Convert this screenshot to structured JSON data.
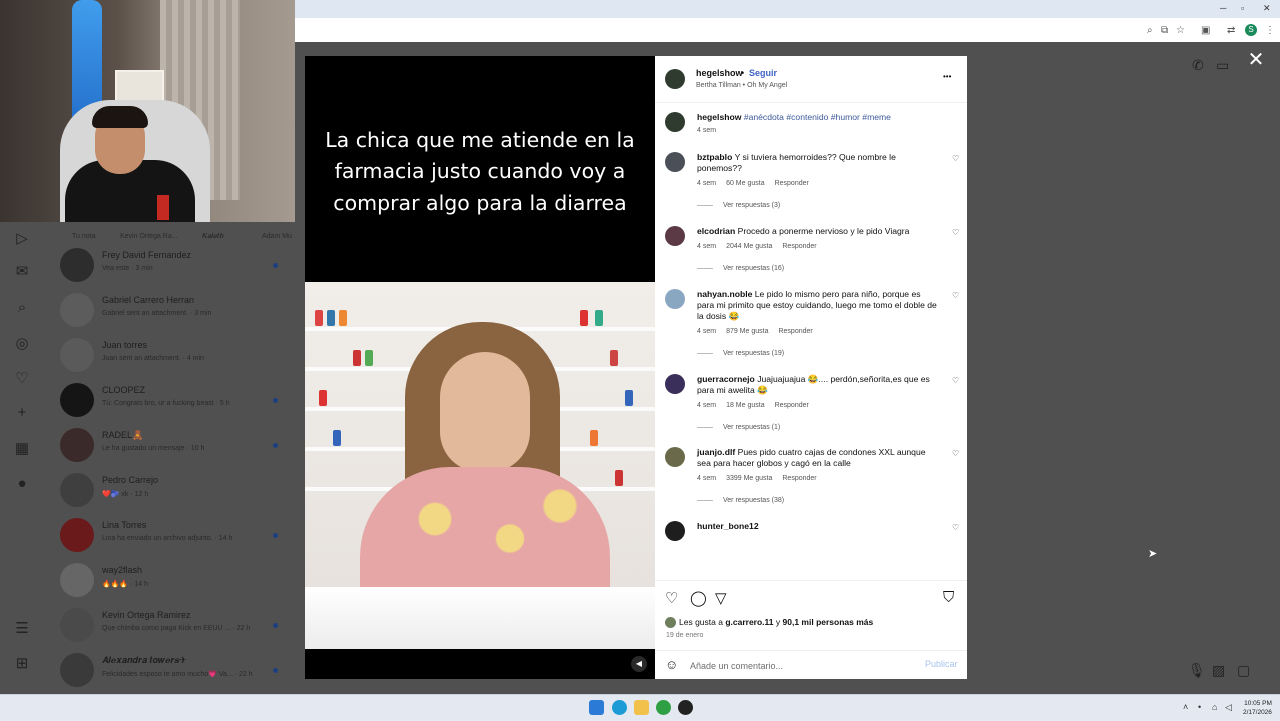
{
  "dm_sidebar": {
    "story_labels": [
      "Tu nota",
      "Kevin Ortega Ra...",
      "𝑲𝒂𝒍𝒆𝒕𝒉",
      "Adam Mu"
    ],
    "conversations": [
      {
        "name": "Frey David Fernandez",
        "preview": "Vea este · 3 min",
        "unread": true
      },
      {
        "name": "Gabriel Carrero Herran",
        "preview": "Gabriel sent an attachment. · 3 min",
        "unread": false
      },
      {
        "name": "Juan torres",
        "preview": "Juan sent an attachment. · 4 min",
        "unread": false
      },
      {
        "name": "CLOOPEZ",
        "preview": "Tú: Congrats bro, ur a fucking beast · 5 h",
        "unread": true
      },
      {
        "name": "RADEL🧸",
        "preview": "Le ha gustado un mensaje · 10 h",
        "unread": true
      },
      {
        "name": "Pedro Carrejo",
        "preview": "❤️🫐 xk · 12 h",
        "unread": false
      },
      {
        "name": "Lina Torres",
        "preview": "Lina ha enviado un archivo adjunto. · 14 h",
        "unread": true
      },
      {
        "name": "way2flash",
        "preview": "🔥🔥🔥 · 14 h",
        "unread": false
      },
      {
        "name": "Kevin Ortega Ramirez",
        "preview": "Que chimba como paga Kick en EEUU ... · 22 h",
        "unread": true
      },
      {
        "name": "𝑨𝒍𝒆𝒙𝒂𝒏𝒅𝒓𝒂 𝒕𝒐𝒘𝒆𝒓𝒔✈",
        "preview": "Felicidades esposo te amo mucho💗 Va... · 22 h",
        "unread": true
      }
    ]
  },
  "post": {
    "author": "hegelshow",
    "separator": "•",
    "follow_label": "Seguir",
    "audio": "Bertha Tillman • Oh My Angel",
    "more_label": "•••",
    "video_caption": [
      "La chica que me atiende en la",
      "farmacia justo cuando voy a",
      "comprar algo para la diarrea"
    ],
    "caption": {
      "author": "hegelshow",
      "text": "#anécdota #contenido #humor #meme",
      "time": "4 sem"
    },
    "comments": [
      {
        "user": "bztpablo",
        "text": "Y si tuviera hemorroides?? Que nombre le ponemos??",
        "time": "4 sem",
        "likes": "60 Me gusta",
        "reply": "Responder",
        "replies": "Ver respuestas (3)"
      },
      {
        "user": "elcodrian",
        "text": "Procedo a ponerme nervioso y le pido Viagra",
        "time": "4 sem",
        "likes": "2044 Me gusta",
        "reply": "Responder",
        "replies": "Ver respuestas (16)"
      },
      {
        "user": "nahyan.noble",
        "text": "Le pido lo mismo pero para niño, porque es para mi primito que estoy cuidando, luego me tomo el doble de la dosis 😂",
        "time": "4 sem",
        "likes": "879 Me gusta",
        "reply": "Responder",
        "replies": "Ver respuestas (19)"
      },
      {
        "user": "guerracornejo",
        "text": "Juajuajuajua 😂.... perdón,señorita,es que es para mi awelita 😂",
        "time": "4 sem",
        "likes": "18 Me gusta",
        "reply": "Responder",
        "replies": "Ver respuestas (1)"
      },
      {
        "user": "juanjo.dlf",
        "text": "Pues pido cuatro cajas de condones XXL aunque sea para hacer globos y cagó en la calle",
        "time": "4 sem",
        "likes": "3399 Me gusta",
        "reply": "Responder",
        "replies": "Ver respuestas (38)"
      },
      {
        "user": "hunter_bone12",
        "text": "",
        "time": "",
        "likes": "",
        "reply": "",
        "replies": ""
      }
    ],
    "likes": {
      "prefix": "Les gusta a",
      "user": "g.carrero.11",
      "middle": "y",
      "rest": "90,1 mil personas más"
    },
    "date": "19 de enero",
    "comment_placeholder": "Añade un comentario...",
    "publish_label": "Publicar",
    "close_label": "✕"
  },
  "taskbar": {
    "time": "10:05 PM",
    "date": "2/17/2026"
  },
  "colors": {
    "link_blue": "#3d5a99",
    "follow_blue": "#3e63c8",
    "publish_disabled": "#a9c3ee"
  }
}
